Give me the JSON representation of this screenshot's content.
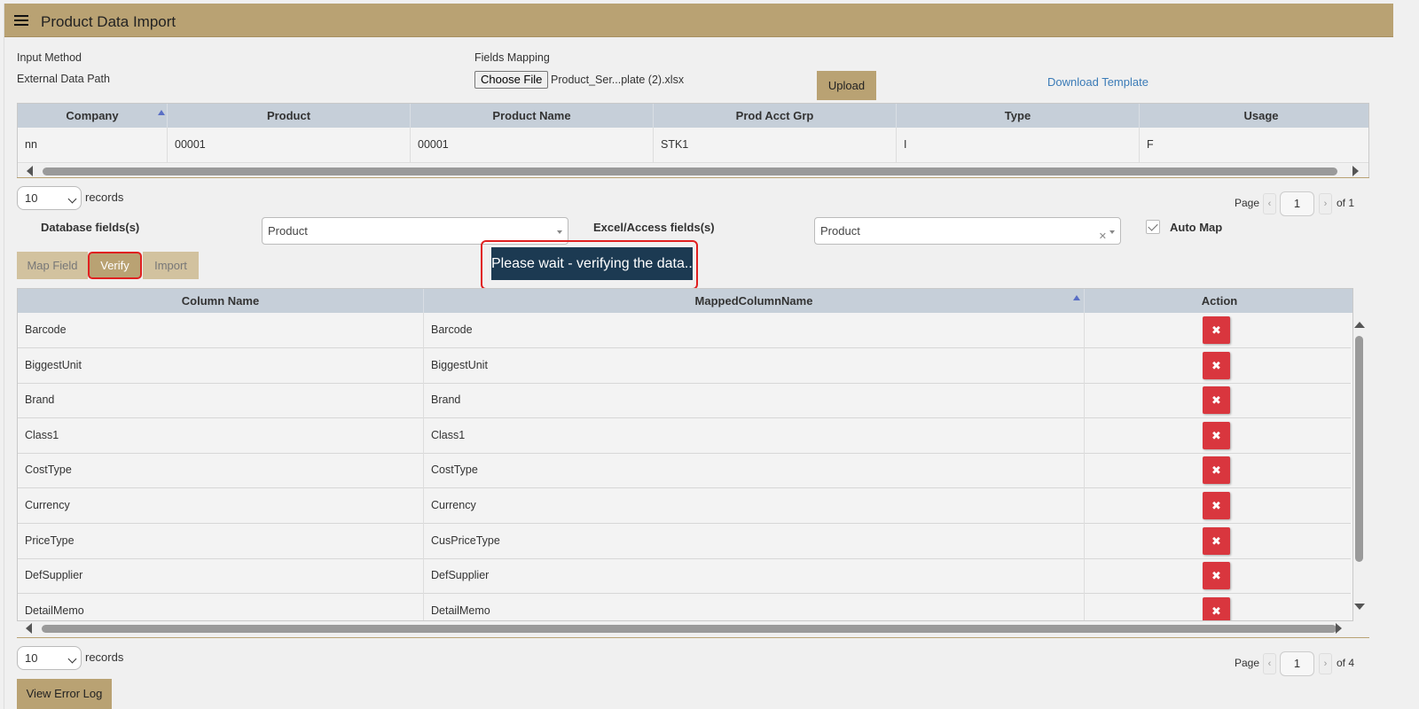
{
  "app": {
    "title": "Product Data Import"
  },
  "form": {
    "input_method_label": "Input Method",
    "external_data_path_label": "External Data Path",
    "fields_mapping_label": "Fields Mapping",
    "choose_file_label": "Choose File",
    "file_name": "Product_Ser...plate (2).xlsx",
    "upload_label": "Upload",
    "download_template_label": "Download Template"
  },
  "preview_grid": {
    "columns": [
      "Company",
      "Product",
      "Product Name",
      "Prod Acct Grp",
      "Type",
      "Usage"
    ],
    "rows": [
      [
        "nn",
        "00001",
        "00001",
        "STK1",
        "I",
        "F"
      ]
    ]
  },
  "pager_top": {
    "page_size": "10",
    "records_label": "records",
    "page_label": "Page",
    "page": "1",
    "of_label": "of 1"
  },
  "mapping": {
    "db_fields_label": "Database fields(s)",
    "db_field_value": "Product",
    "excel_fields_label": "Excel/Access fields(s)",
    "excel_field_value": "Product",
    "auto_map_label": "Auto Map",
    "auto_map_checked": true,
    "map_field_label": "Map Field",
    "verify_label": "Verify",
    "import_label": "Import",
    "wait_message": "Please wait - verifying the data...."
  },
  "mapped_grid": {
    "columns": [
      "Column Name",
      "MappedColumnName",
      "Action"
    ],
    "rows": [
      [
        "Barcode",
        "Barcode"
      ],
      [
        "BiggestUnit",
        "BiggestUnit"
      ],
      [
        "Brand",
        "Brand"
      ],
      [
        "Class1",
        "Class1"
      ],
      [
        "CostType",
        "CostType"
      ],
      [
        "Currency",
        "Currency"
      ],
      [
        "PriceType",
        "CusPriceType"
      ],
      [
        "DefSupplier",
        "DefSupplier"
      ],
      [
        "DetailMemo",
        "DetailMemo"
      ]
    ],
    "delete_icon": "close-icon"
  },
  "pager_bottom": {
    "page_size": "10",
    "records_label": "records",
    "page_label": "Page",
    "page": "1",
    "of_label": "of 4"
  },
  "view_error_log_label": "View Error Log",
  "colors": {
    "accent": "#b9a273",
    "header": "#c6cfd9",
    "danger": "#d9363e",
    "wait_bg": "#1c3a52",
    "highlight": "#e02020"
  }
}
